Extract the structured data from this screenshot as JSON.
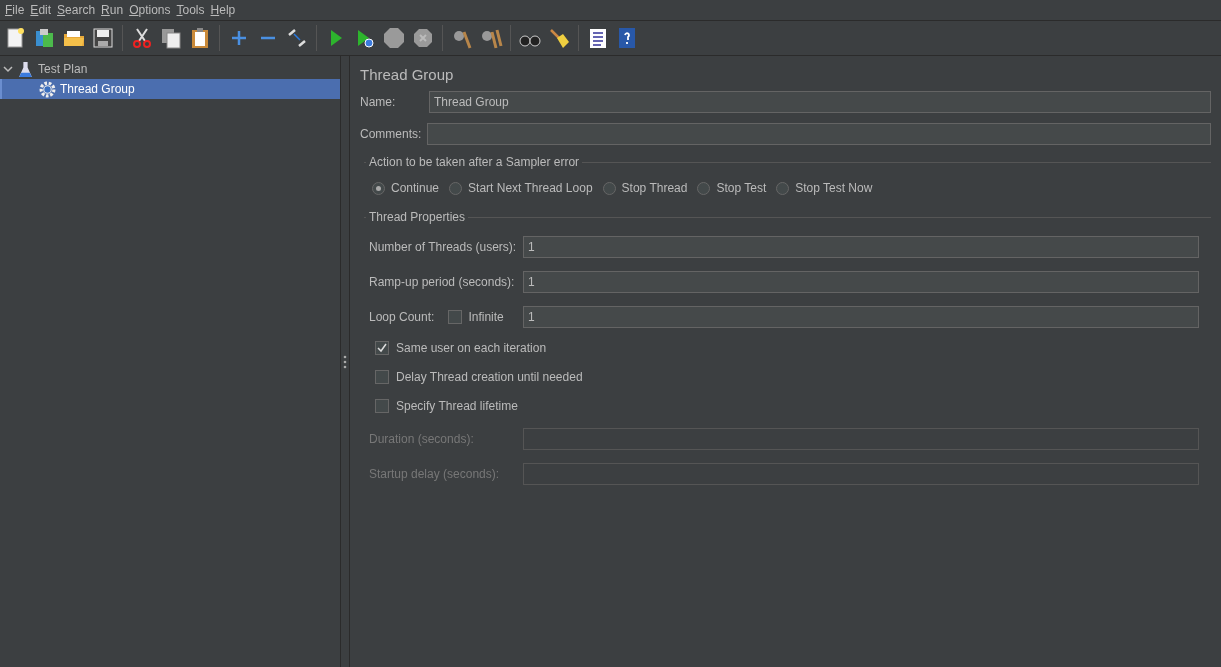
{
  "menu": [
    "File",
    "Edit",
    "Search",
    "Run",
    "Options",
    "Tools",
    "Help"
  ],
  "tree": [
    {
      "label": "Test Plan",
      "expanded": true,
      "selected": false,
      "children": [
        {
          "label": "Thread Group",
          "selected": true
        }
      ]
    }
  ],
  "panel": {
    "title": "Thread Group",
    "name": {
      "label": "Name:",
      "value": "Thread Group"
    },
    "comments": {
      "label": "Comments:"
    },
    "error_action": {
      "title": "Action to be taken after a Sampler error",
      "options": [
        {
          "label": "Continue",
          "selected": true
        },
        {
          "label": "Start Next Thread Loop",
          "selected": false
        },
        {
          "label": "Stop Thread",
          "selected": false
        },
        {
          "label": "Stop Test",
          "selected": false
        },
        {
          "label": "Stop Test Now",
          "selected": false
        }
      ]
    },
    "thread_properties": {
      "title": "Thread Properties",
      "threads": {
        "label": "Number of Threads (users):",
        "value": "1"
      },
      "ramp_up": {
        "label": "Ramp-up period (seconds):",
        "value": "1"
      },
      "loop": {
        "label": "Loop Count:",
        "infinite": {
          "label": "Infinite",
          "checked": false
        },
        "value": "1"
      },
      "checkboxes": [
        {
          "label": "Same user on each iteration",
          "checked": true
        },
        {
          "label": "Delay Thread creation until needed",
          "checked": false
        },
        {
          "label": "Specify Thread lifetime",
          "checked": false
        }
      ],
      "duration": {
        "label": "Duration (seconds):",
        "disabled": true
      },
      "startup_delay": {
        "label": "Startup delay (seconds):",
        "disabled": true
      }
    }
  }
}
